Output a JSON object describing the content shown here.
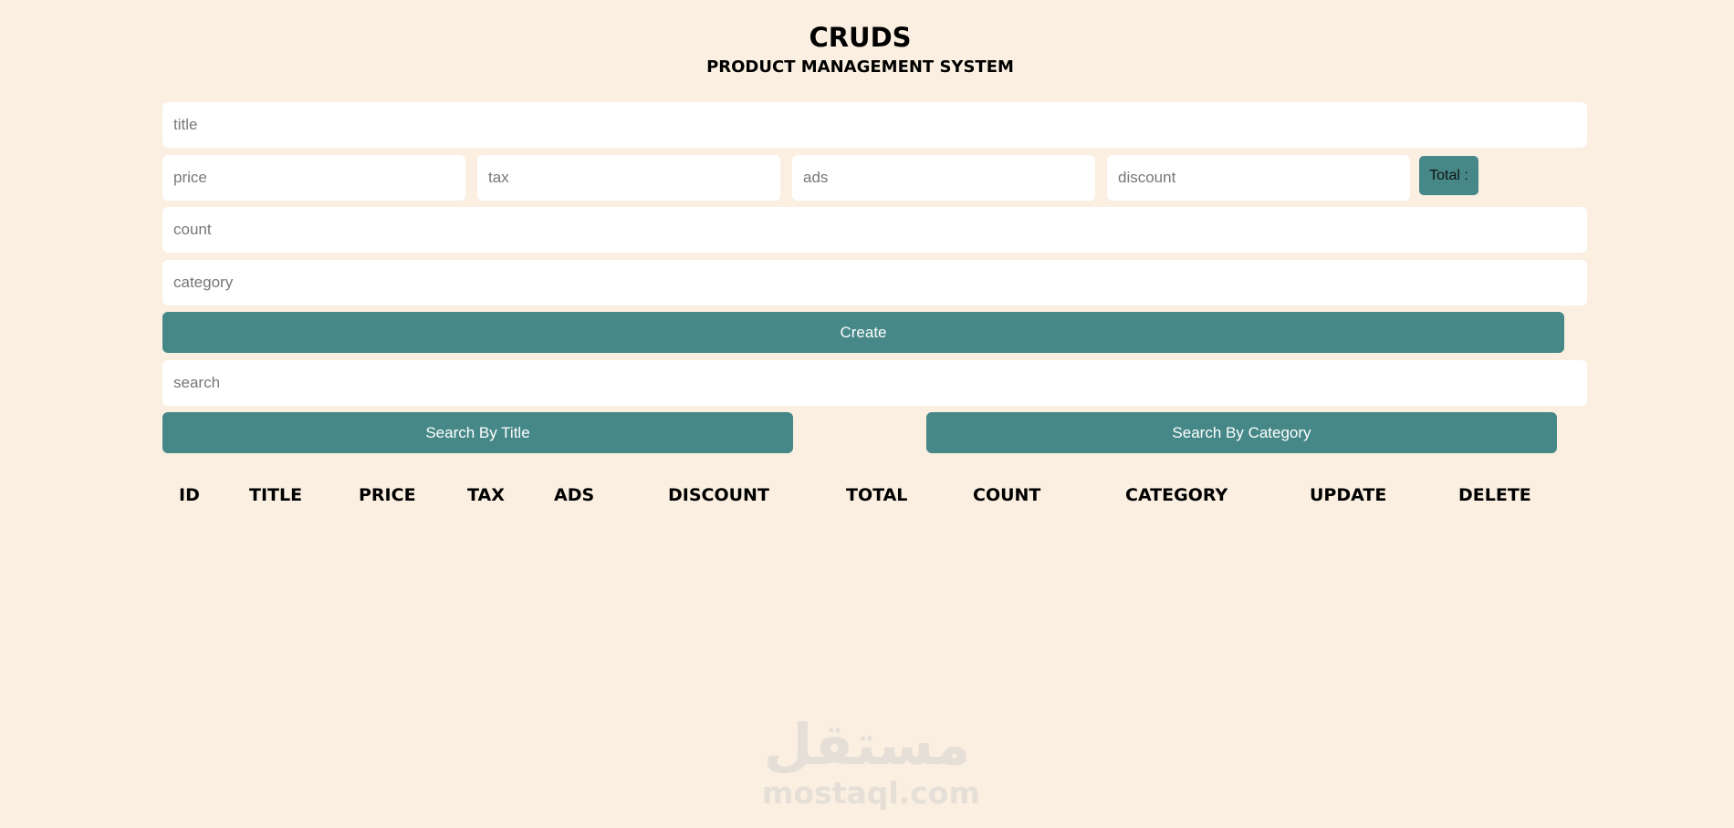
{
  "header": {
    "title": "CRUDS",
    "subtitle": "PRODUCT MANAGEMENT SYSTEM"
  },
  "form": {
    "title_placeholder": "title",
    "price_placeholder": "price",
    "tax_placeholder": "tax",
    "ads_placeholder": "ads",
    "discount_placeholder": "discount",
    "total_label": "Total :",
    "count_placeholder": "count",
    "category_placeholder": "category",
    "create_label": "Create"
  },
  "search": {
    "placeholder": "search",
    "by_title_label": "Search By Title",
    "by_category_label": "Search By Category"
  },
  "table": {
    "columns": [
      "ID",
      "TITLE",
      "PRICE",
      "TAX",
      "ADS",
      "DISCOUNT",
      "TOTAL",
      "COUNT",
      "CATEGORY",
      "UPDATE",
      "DELETE"
    ],
    "rows": []
  },
  "watermark": {
    "arabic": "مستقل",
    "latin": "mostaql.com"
  },
  "colors": {
    "background": "#faefe1",
    "accent": "#468888",
    "input_background": "#ffffff"
  }
}
